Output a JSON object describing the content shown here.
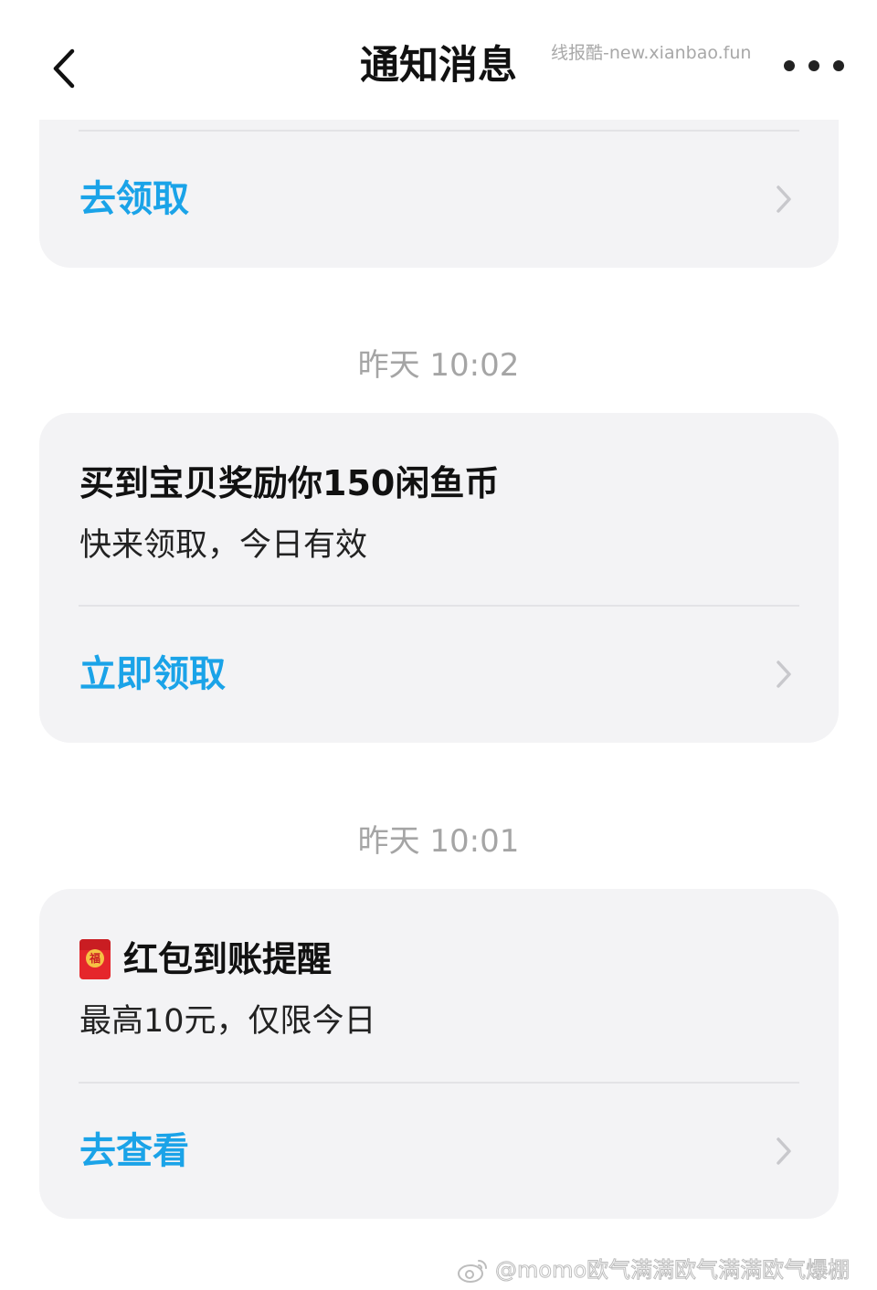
{
  "header": {
    "title": "通知消息",
    "watermark": "线报酷-new.xianbao.fun"
  },
  "cards": [
    {
      "action_label": "去领取"
    },
    {
      "timestamp": "昨天 10:02",
      "title": "买到宝贝奖励你150闲鱼币",
      "subtitle": "快来领取，今日有效",
      "action_label": "立即领取"
    },
    {
      "timestamp": "昨天 10:01",
      "title": "红包到账提醒",
      "subtitle": "最高10元，仅限今日",
      "action_label": "去查看",
      "icon_char": "福"
    }
  ],
  "footer": {
    "watermark": "@momo欧气满满欧气满满欧气爆棚"
  },
  "colors": {
    "accent": "#1aa3e8",
    "card_bg": "#f3f3f5",
    "timestamp": "#a5a5a5"
  },
  "icons": {
    "back": "chevron-left-icon",
    "more": "more-dots-icon",
    "chevron": "chevron-right-icon",
    "red_packet": "red-packet-icon",
    "weibo": "weibo-icon"
  }
}
